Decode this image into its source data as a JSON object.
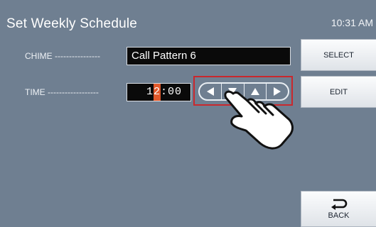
{
  "header": {
    "title": "Set Weekly Schedule",
    "clock": "10:31 AM"
  },
  "form": {
    "chime_label": "CHIME ----------------",
    "chime_value": "Call Pattern 6",
    "time_label": "TIME ------------------",
    "time_digit_1": "1",
    "time_digit_active": "2",
    "time_rest": ":00"
  },
  "arrows": [
    "left-arrow-icon",
    "down-arrow-icon",
    "up-arrow-icon",
    "right-arrow-icon"
  ],
  "buttons": {
    "select": "SELECT",
    "edit": "EDIT",
    "back": "BACK"
  },
  "colors": {
    "background": "#6f7f91",
    "active_digit": "#e2592b",
    "highlight": "#c9282d"
  }
}
